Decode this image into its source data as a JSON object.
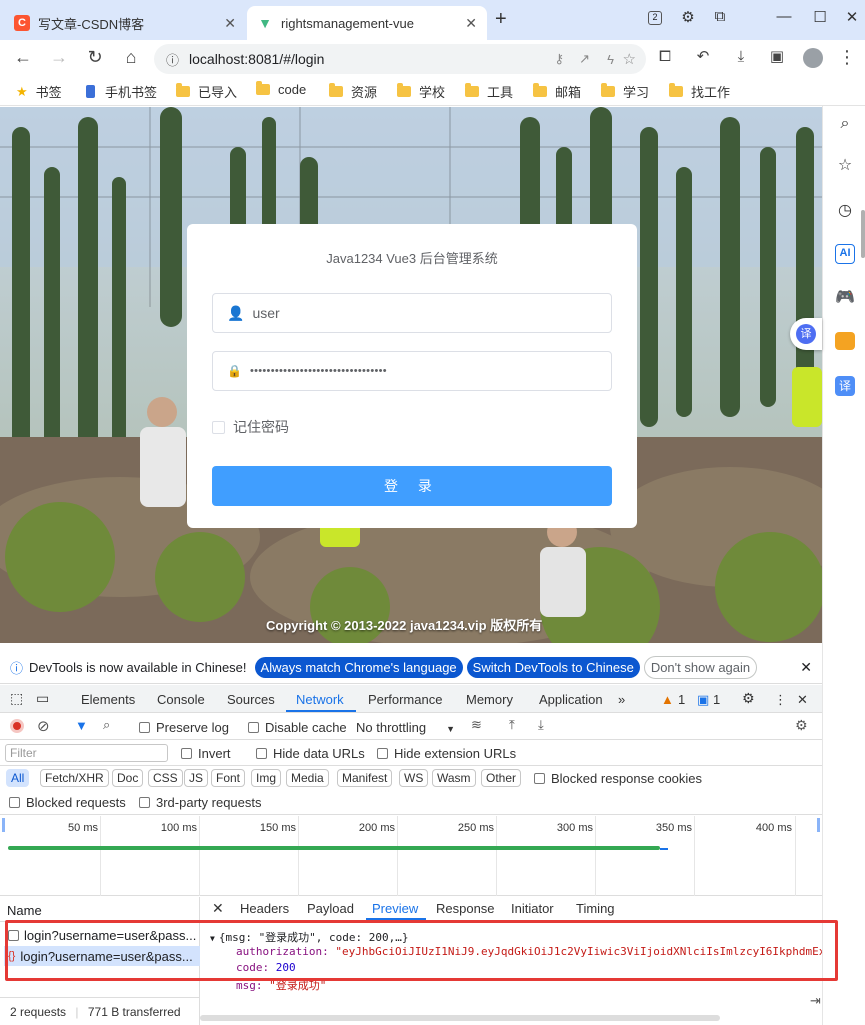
{
  "tabs": [
    {
      "title": "写文章-CSDN博客",
      "favicon": "C",
      "favicon_color": "#fc5531"
    },
    {
      "title": "rightsmanagement-vue",
      "favicon": "V",
      "favicon_color": "#41b883"
    }
  ],
  "tab_counter": "2",
  "address": {
    "url": "localhost:8081/#/login"
  },
  "bookmarks": [
    "书签",
    "手机书签",
    "已导入",
    "code",
    "资源",
    "学校",
    "工具",
    "邮箱",
    "学习",
    "找工作"
  ],
  "sidebar_badge": "AI",
  "floating_translate": "译",
  "login": {
    "title": "Java1234 Vue3 后台管理系统",
    "username": "user",
    "password_mask": "•••••••••••••••••••••••••••••••••",
    "remember": "记住密码",
    "submit": "登 录",
    "copyright": "Copyright © 2013-2022 java1234.vip 版权所有"
  },
  "devtools": {
    "info_text": "DevTools is now available in Chinese!",
    "btn_match": "Always match Chrome's language",
    "btn_switch": "Switch DevTools to Chinese",
    "btn_dont": "Don't show again",
    "tabs": [
      "Elements",
      "Console",
      "Sources",
      "Network",
      "Performance",
      "Memory",
      "Application"
    ],
    "active_tab": "Network",
    "warn_count": "1",
    "msg_count": "1",
    "preserve_log": "Preserve log",
    "disable_cache": "Disable cache",
    "throttling": "No throttling",
    "filter_placeholder": "Filter",
    "invert": "Invert",
    "hide_data": "Hide data URLs",
    "hide_ext": "Hide extension URLs",
    "types": [
      "All",
      "Fetch/XHR",
      "Doc",
      "CSS",
      "JS",
      "Font",
      "Img",
      "Media",
      "Manifest",
      "WS",
      "Wasm",
      "Other"
    ],
    "blocked_cookies": "Blocked response cookies",
    "blocked_requests": "Blocked requests",
    "third_party": "3rd-party requests",
    "ticks": [
      "50 ms",
      "100 ms",
      "150 ms",
      "200 ms",
      "250 ms",
      "300 ms",
      "350 ms",
      "400 ms"
    ],
    "name_header": "Name",
    "requests": [
      "login?username=user&pass...",
      "login?username=user&pass..."
    ],
    "detail_tabs": [
      "Headers",
      "Payload",
      "Preview",
      "Response",
      "Initiator",
      "Timing"
    ],
    "active_detail": "Preview",
    "preview": {
      "summary": "{msg: \"登录成功\", code: 200,…}",
      "auth_key": "authorization:",
      "auth_val": "\"eyJhbGciOiJIUzI1NiJ9.eyJqdGkiOiJ1c2VyIiwic3ViIjoidXNlciIsImlzcyI6IkphdmExMjM0Iiwia",
      "code_key": "code:",
      "code_val": "200",
      "msg_key": "msg:",
      "msg_val": "\"登录成功\""
    },
    "status_requests": "2 requests",
    "status_transferred": "771 B transferred"
  }
}
